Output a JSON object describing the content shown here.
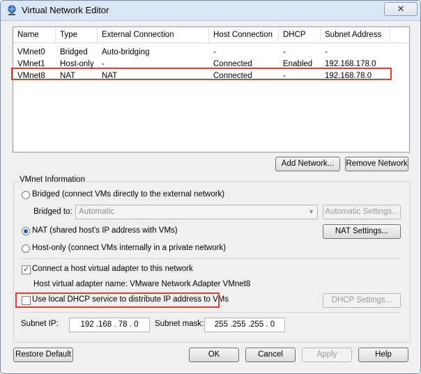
{
  "window": {
    "title": "Virtual Network Editor",
    "close_label": "✕"
  },
  "table": {
    "columns": [
      "Name",
      "Type",
      "External Connection",
      "Host Connection",
      "DHCP",
      "Subnet Address"
    ],
    "rows": [
      [
        "VMnet0",
        "Bridged",
        "Auto-bridging",
        "-",
        "-",
        "-"
      ],
      [
        "VMnet1",
        "Host-only",
        "-",
        "Connected",
        "Enabled",
        "192.168.178.0"
      ],
      [
        "VMnet8",
        "NAT",
        "NAT",
        "Connected",
        "-",
        "192.168.78.0"
      ]
    ],
    "selected_row": "VMnet8"
  },
  "actions": {
    "add_network": "Add Network...",
    "remove_network": "Remove Network"
  },
  "vmnet_info": {
    "group_label": "VMnet Information",
    "bridged_label": "Bridged (connect VMs directly to the external network)",
    "bridged_to_label": "Bridged to:",
    "bridged_to_value": "Automatic",
    "auto_settings": "Automatic Settings...",
    "nat_label": "NAT (shared host's IP address with VMs)",
    "nat_settings": "NAT Settings...",
    "hostonly_label": "Host-only (connect VMs internally in a private network)",
    "connect_adapter_label": "Connect a host virtual adapter to this network",
    "adapter_name_label": "Host virtual adapter name: VMware Network Adapter VMnet8",
    "dhcp_label": "Use local DHCP service to distribute IP address to VMs",
    "dhcp_settings": "DHCP Settings...",
    "subnet_ip_label": "Subnet IP:",
    "subnet_ip": "192 .168 . 78 .  0",
    "subnet_mask_label": "Subnet mask:",
    "subnet_mask": "255 .255 .255 .  0",
    "selected_mode": "NAT",
    "connect_adapter_checked": true,
    "dhcp_checked": false
  },
  "footer": {
    "restore": "Restore Default",
    "ok": "OK",
    "cancel": "Cancel",
    "apply": "Apply",
    "help": "Help"
  },
  "colors": {
    "highlight_border": "#e03a3a",
    "radio_dot": "#1c5fb5"
  },
  "icons": {
    "title_icon": "network-globe-icon",
    "check_mark": "✓"
  }
}
